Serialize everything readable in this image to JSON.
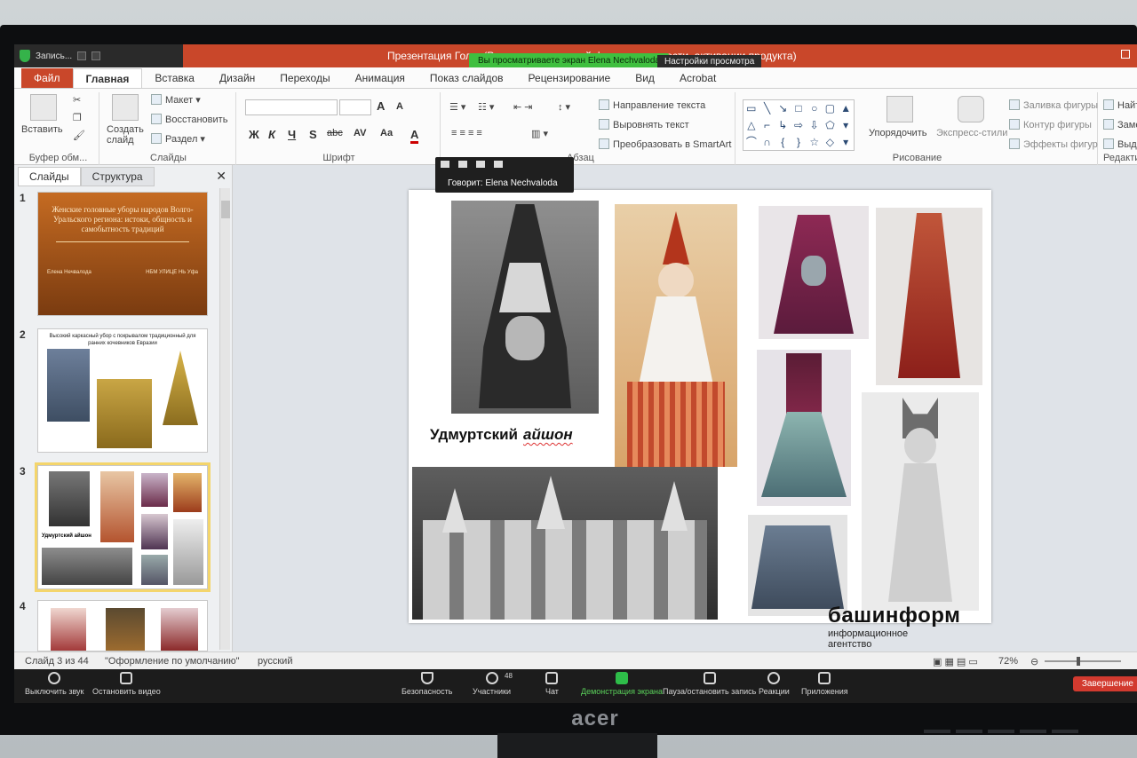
{
  "window": {
    "rec_label": "Запись...",
    "title": "Презентация Гол... (Режим ограниченной функциональности, активации продукта)",
    "viewing_banner": "Вы просматриваете экран Elena Nechvaloda",
    "view_settings": "Настройки просмотра"
  },
  "ribbon_tabs": [
    "Файл",
    "Главная",
    "Вставка",
    "Дизайн",
    "Переходы",
    "Анимация",
    "Показ слайдов",
    "Рецензирование",
    "Вид",
    "Acrobat"
  ],
  "ribbon": {
    "clipboard": {
      "paste": "Вставить",
      "label": "Буфер обм..."
    },
    "slides": {
      "new_slide": "Создать слайд",
      "layout": "Макет",
      "reset": "Восстановить",
      "section": "Раздел",
      "label": "Слайды"
    },
    "font": {
      "label": "Шрифт",
      "bold": "Ж",
      "italic": "К",
      "underline": "Ч",
      "shadow": "S",
      "strike": "abc",
      "spacing": "AV",
      "case": "Aa",
      "color": "A"
    },
    "paragraph": {
      "label": "Абзац",
      "text_direction": "Направление текста",
      "align_text": "Выровнять текст",
      "smartart": "Преобразовать в SmartArt"
    },
    "drawing": {
      "arrange": "Упорядочить",
      "quick_styles": "Экспресс-стили",
      "fill": "Заливка фигуры",
      "outline": "Контур фигуры",
      "effects": "Эффекты фигур",
      "label": "Рисование"
    },
    "editing": {
      "find": "Найти",
      "replace": "Заменить",
      "select": "Выделить",
      "label": "Редактирование"
    }
  },
  "zoom_mini": {
    "speaking": "Говорит: Elena Nechvaloda"
  },
  "panel": {
    "tabs": [
      "Слайды",
      "Структура"
    ],
    "slide1": {
      "title": "Женские головные уборы народов Волго-Уральского региона: истоки, общность и самобытность традиций",
      "author": "Елена Нечвалода",
      "org": "НБМ УЛИЦЕ НЬ Уфа"
    },
    "slide2_title": "Высокий каркасный убор с покрывалом традиционный для ранних кочевников Евразии",
    "slide3_caption": "Удмуртский айшон",
    "numbers": [
      "1",
      "2",
      "3",
      "4"
    ]
  },
  "slide": {
    "caption_main": "Удмуртский",
    "caption_italic": "айшон"
  },
  "watermark": {
    "brand": "башинформ",
    "sub1": "информационное",
    "sub2": "агентство"
  },
  "status": {
    "slide_of": "Слайд 3 из 44",
    "theme": "\"Оформление по умолчанию\"",
    "lang": "русский",
    "zoom": "72%"
  },
  "zoom_toolbar": {
    "mute": "Выключить звук",
    "video": "Остановить видео",
    "security": "Безопасность",
    "participants": "Участники",
    "participants_count": "48",
    "chat": "Чат",
    "share": "Демонстрация экрана",
    "pause": "Пауза/остановить запись",
    "reactions": "Реакции",
    "apps": "Приложения",
    "end": "Завершение"
  },
  "brand": "acer"
}
